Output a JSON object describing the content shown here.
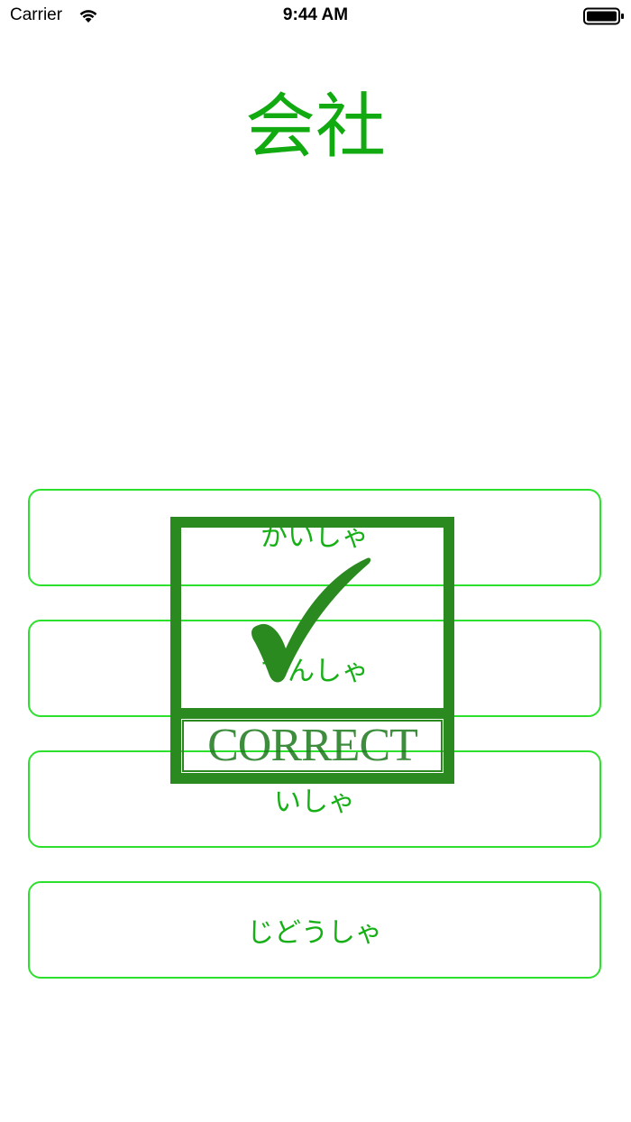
{
  "status_bar": {
    "carrier": "Carrier",
    "time": "9:44 AM"
  },
  "question": {
    "word": "会社"
  },
  "answers": [
    {
      "label": "かいしゃ"
    },
    {
      "label": "でんしゃ"
    },
    {
      "label": "いしゃ"
    },
    {
      "label": "じどうしゃ"
    }
  ],
  "feedback": {
    "label": "CORRECT",
    "icon": "checkmark-icon",
    "color": "#2a8a1f"
  },
  "colors": {
    "accent": "#11aa11",
    "button_border": "#2ee02e"
  }
}
